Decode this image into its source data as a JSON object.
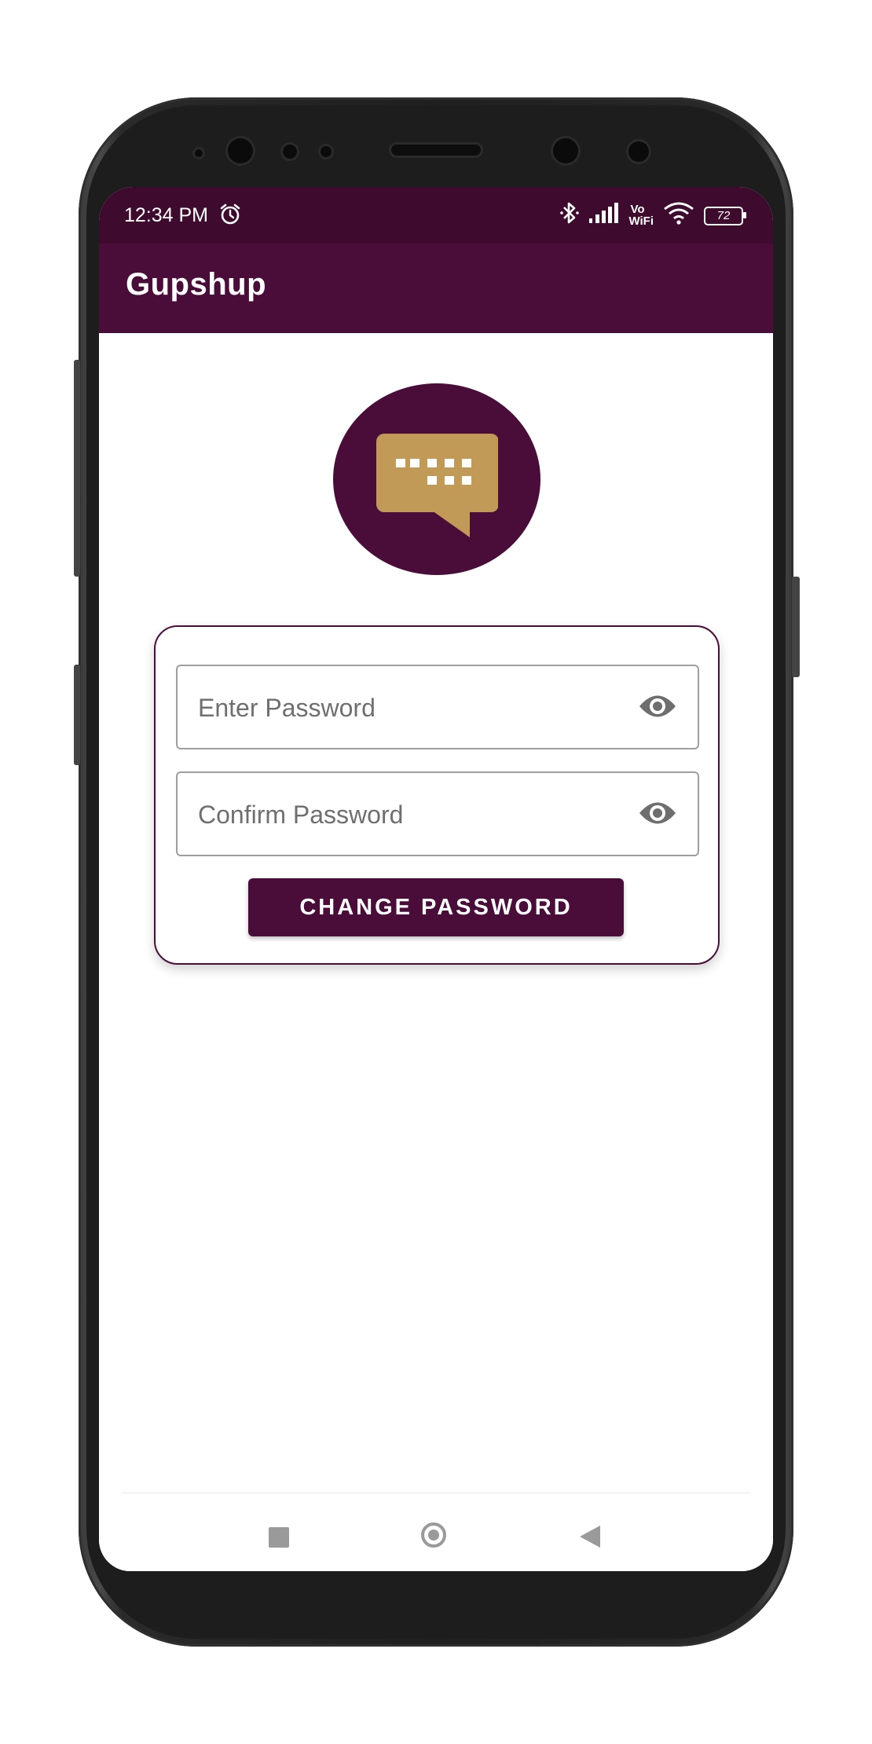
{
  "status_bar": {
    "time": "12:34 PM",
    "alarm_icon": "alarm-clock-icon",
    "bluetooth_icon": "bluetooth-icon",
    "signal_icon": "cell-signal-icon",
    "vowifi_label_top": "Vo",
    "vowifi_label_bottom": "WiFi",
    "wifi_icon": "wifi-icon",
    "battery_level": "72"
  },
  "app_bar": {
    "title": "Gupshup"
  },
  "logo": {
    "icon": "chat-keyboard-bubble-icon",
    "background_color": "#4a0d3a",
    "bubble_color": "#c09a56"
  },
  "form": {
    "password": {
      "placeholder": "Enter Password",
      "value": "",
      "toggle_icon": "eye-icon"
    },
    "confirm_password": {
      "placeholder": "Confirm Password",
      "value": "",
      "toggle_icon": "eye-icon"
    },
    "submit_label": "CHANGE PASSWORD"
  },
  "nav_bar": {
    "recents_icon": "square-recents-icon",
    "home_icon": "circle-home-icon",
    "back_icon": "triangle-back-icon"
  },
  "colors": {
    "primary": "#4a0d3a",
    "status_bar": "#3e0a2e",
    "accent": "#c09a56"
  }
}
